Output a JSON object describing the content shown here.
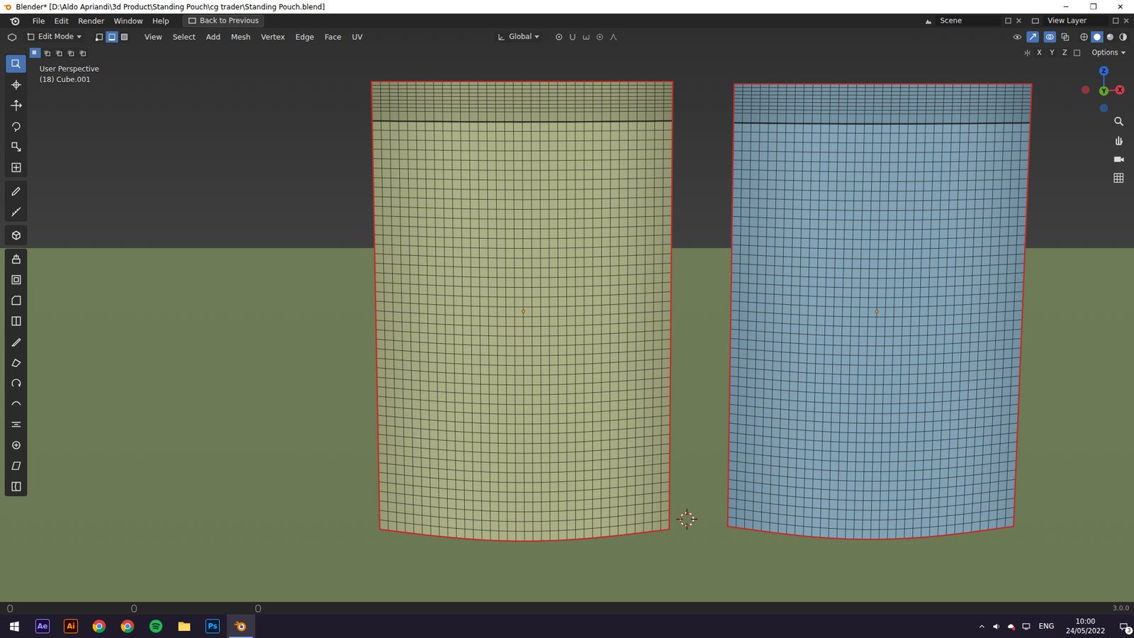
{
  "window": {
    "title": "Blender* [D:\\Aldo Apriandi\\3d Product\\Standing Pouch\\cg trader\\Standing Pouch.blend]",
    "controls": [
      "─",
      "❐",
      "✕"
    ]
  },
  "menu": [
    "File",
    "Edit",
    "Render",
    "Window",
    "Help"
  ],
  "back_button": "Back to Previous",
  "scene": "Scene",
  "view_layer": "View Layer",
  "viewport_header": {
    "mode": "Edit Mode",
    "select_modes": [
      {
        "kind": "vertex",
        "selected": false
      },
      {
        "kind": "edge",
        "selected": true
      },
      {
        "kind": "face",
        "selected": false
      }
    ],
    "menus": [
      "View",
      "Select",
      "Add",
      "Mesh",
      "Vertex",
      "Edge",
      "Face",
      "UV"
    ],
    "orientation": "Global",
    "box_modes": [
      {
        "kind": "set",
        "selected": true
      },
      {
        "kind": "extend",
        "selected": false
      },
      {
        "kind": "subtract",
        "selected": false
      },
      {
        "kind": "invert",
        "selected": false
      },
      {
        "kind": "intersect",
        "selected": false
      }
    ],
    "axes": [
      "X",
      "Y",
      "Z"
    ],
    "options": "Options"
  },
  "overlay": {
    "view": "User Perspective",
    "object": "(18) Cube.001"
  },
  "tools": [
    {
      "kind": "select-box",
      "selected": true
    },
    {
      "kind": "cursor",
      "selected": false
    },
    {
      "kind": "move",
      "selected": false
    },
    {
      "kind": "rotate",
      "selected": false
    },
    {
      "kind": "scale",
      "selected": false
    },
    {
      "kind": "transform",
      "selected": false
    },
    {
      "kind": "annotate",
      "selected": false
    },
    {
      "kind": "measure",
      "selected": false
    },
    {
      "kind": "add-cube",
      "selected": false
    },
    {
      "kind": "extrude",
      "selected": false
    },
    {
      "kind": "inset",
      "selected": false
    },
    {
      "kind": "bevel",
      "selected": false
    },
    {
      "kind": "loop-cut",
      "selected": false
    },
    {
      "kind": "knife",
      "selected": false
    },
    {
      "kind": "poly-build",
      "selected": false
    },
    {
      "kind": "spin",
      "selected": false
    },
    {
      "kind": "smooth",
      "selected": false
    },
    {
      "kind": "edge-slide",
      "selected": false
    },
    {
      "kind": "shrink-fatten",
      "selected": false
    },
    {
      "kind": "shear",
      "selected": false
    },
    {
      "kind": "rip",
      "selected": false
    }
  ],
  "gizmo": [
    {
      "label": "Z",
      "color": "#2e6bd6"
    },
    {
      "label": "Y",
      "color": "#62a12c"
    },
    {
      "label": "X",
      "color": "#d33a4e"
    }
  ],
  "objects": [
    {
      "color": "#a8ac80",
      "selected": true
    },
    {
      "color": "#7c9fb2",
      "selected": true
    }
  ],
  "status_bar": {
    "version": "3.0.0"
  },
  "taskbar": {
    "apps": [
      {
        "kind": "ae",
        "label": "Ae",
        "active": false
      },
      {
        "kind": "ai",
        "label": "Ai",
        "active": false
      },
      {
        "kind": "chrome",
        "active": false
      },
      {
        "kind": "chrome",
        "active": false
      },
      {
        "kind": "spotify",
        "active": false
      },
      {
        "kind": "explorer",
        "active": false
      },
      {
        "kind": "ps",
        "label": "Ps",
        "active": false
      },
      {
        "kind": "blender",
        "active": true
      }
    ],
    "language": "ENG",
    "time": "10:00",
    "date": "24/05/2022",
    "notifications": "3"
  }
}
